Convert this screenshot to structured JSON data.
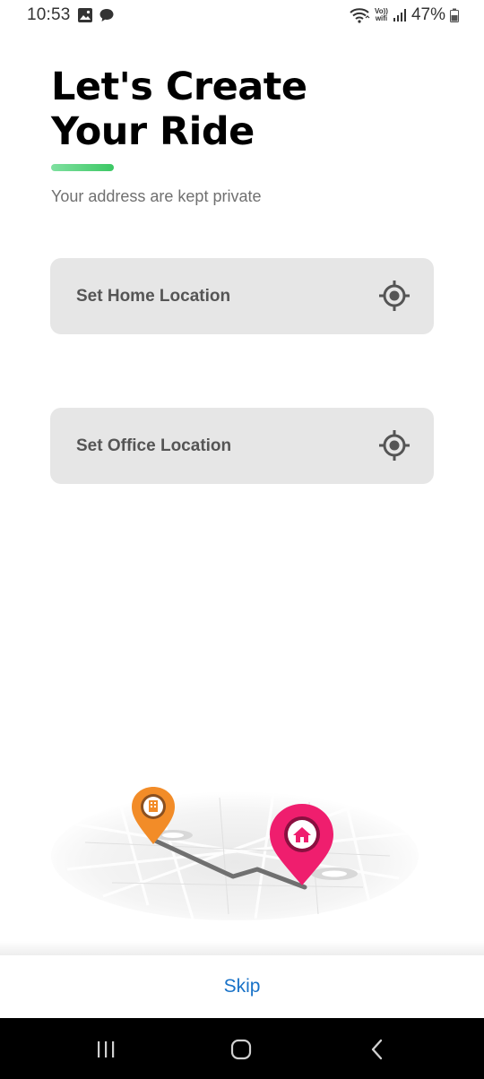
{
  "status_bar": {
    "time": "10:53",
    "network_label": "VoLTE\nwifi",
    "battery_percent": "47%"
  },
  "header": {
    "title_line1": "Let's Create",
    "title_line2": "Your Ride",
    "subtitle": "Your address are kept private"
  },
  "locations": {
    "home_label": "Set Home Location",
    "office_label": "Set Office Location"
  },
  "footer": {
    "skip_label": "Skip"
  },
  "colors": {
    "accent_green": "#3cc864",
    "card_bg": "#e6e6e6",
    "skip_blue": "#1a73c8",
    "pin_orange": "#f28c28",
    "pin_pink": "#ef1e6e"
  },
  "icons": {
    "gallery": "image-icon",
    "message": "chat-bubble-icon",
    "wifi": "wifi-icon",
    "signal": "signal-bars-icon",
    "battery": "battery-icon",
    "locate": "crosshair-target-icon",
    "recents": "recents-icon",
    "home": "home-circle-icon",
    "back": "back-chevron-icon"
  }
}
